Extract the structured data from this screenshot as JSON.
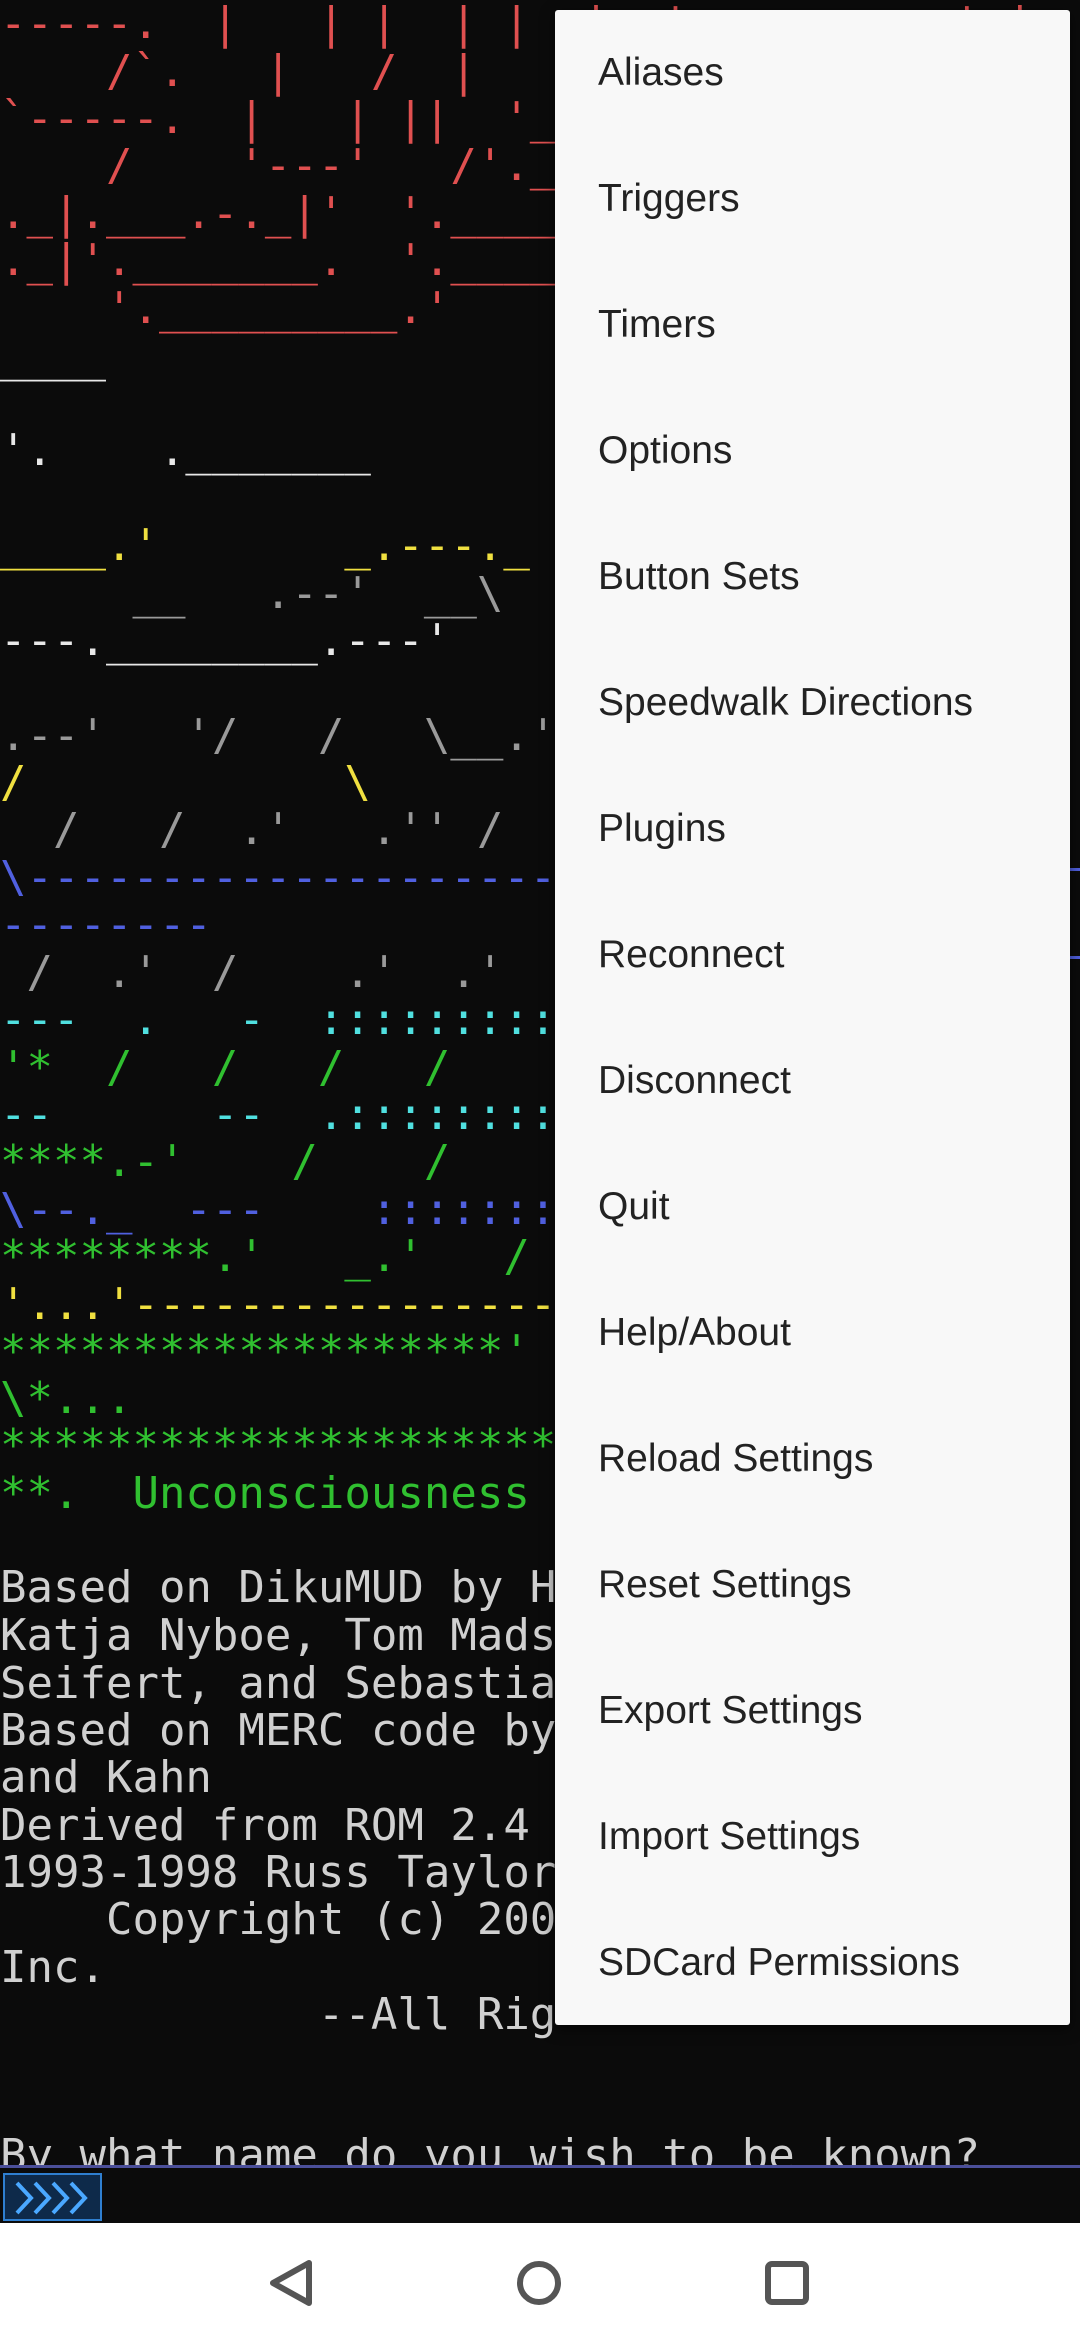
{
  "terminal": {
    "lines": [
      {
        "text": "-----.  |   | |  | |  |  '          ' |",
        "color": "#e05050"
      },
      {
        "text": "    /`.   |   /  |   '    `--._",
        "color": "#e05050"
      },
      {
        "text": "`-----.  |   | ||  '_____.-'",
        "color": "#e05050"
      },
      {
        "text": "    /    '---'   /'.____",
        "color": "#e05050"
      },
      {
        "text": "._|.___.-._|'  '.______.-'_|",
        "color": "#e05050"
      },
      {
        "text": "._|'._______.  '._______.'",
        "color": "#e05050"
      },
      {
        "text": "    '._________.'",
        "color": "#e05050"
      },
      {
        "text": "____",
        "color": "#e8e8e8"
      },
      {
        "text": "",
        "color": "#e8e8e8"
      },
      {
        "text": "'.    ._______",
        "color": "#e8e8e8"
      },
      {
        "text": "                         __",
        "color": "#9a9a9a"
      },
      {
        "text": "____.'       _.---._",
        "color": "#f0e040"
      },
      {
        "text": "     __   .--'  __\\       /",
        "color": "#9a9a9a"
      },
      {
        "text": "---.________.---'",
        "color": "#e8e8e8"
      },
      {
        "text": "",
        "color": "#e8e8e8"
      },
      {
        "text": ".--'   '/   /   \\__.'",
        "color": "#9a9a9a"
      },
      {
        "text": "/            \\",
        "color": "#f0e040"
      },
      {
        "text": "  /   /  .'   .'' /",
        "color": "#9a9a9a"
      },
      {
        "text": "\\-------------------------------------",
        "color": "#5060e0"
      },
      {
        "text": "--------",
        "color": "#5060e0"
      },
      {
        "text": " /  .'  /    .'  .'",
        "color": "#9a9a9a"
      },
      {
        "text": "---  .   -  :::::::::::::",
        "color": "#50e0e0"
      },
      {
        "text": "'*  /   /   /   /",
        "color": "#30c030"
      },
      {
        "text": "--      --  .:::::::::::",
        "color": "#50e0e0"
      },
      {
        "text": "****.-'    /    /",
        "color": "#30c030"
      },
      {
        "text": "\\--._  ---    :::::::::",
        "color": "#5060e0"
      },
      {
        "text": "********.'   _.'   /",
        "color": "#30c030"
      },
      {
        "text": "'...'-------------------",
        "color": "#f0e040"
      },
      {
        "text": "*******************'",
        "color": "#30c030"
      },
      {
        "text": "\\*...",
        "color": "#30c030"
      },
      {
        "text": "**********************",
        "color": "#30c030"
      },
      {
        "text": "**.  Unconsciousness",
        "color": "#30c030"
      },
      {
        "text": "",
        "color": "#d0d0d0"
      },
      {
        "text": "Based on DikuMUD by H",
        "color": "#d0d0d0"
      },
      {
        "text": "Katja Nyboe, Tom Mads",
        "color": "#d0d0d0"
      },
      {
        "text": "Seifert, and Sebastia",
        "color": "#d0d0d0"
      },
      {
        "text": "Based on MERC code by",
        "color": "#d0d0d0"
      },
      {
        "text": "and Kahn",
        "color": "#d0d0d0"
      },
      {
        "text": "Derived from ROM 2.4",
        "color": "#d0d0d0"
      },
      {
        "text": "1993-1998 Russ Taylor",
        "color": "#d0d0d0"
      },
      {
        "text": "    Copyright (c) 200",
        "color": "#d0d0d0"
      },
      {
        "text": "Inc.",
        "color": "#d0d0d0"
      },
      {
        "text": "            --All Rig",
        "color": "#d0d0d0"
      },
      {
        "text": "",
        "color": "#d0d0d0"
      },
      {
        "text": "",
        "color": "#d0d0d0"
      },
      {
        "text": "By what name do you wish to be known?",
        "color": "#d0d0d0"
      }
    ]
  },
  "input_bar": {
    "button_icon": "chevrons-right-icon",
    "accent": "#2f7fd0"
  },
  "menu": {
    "items": [
      "Aliases",
      "Triggers",
      "Timers",
      "Options",
      "Button Sets",
      "Speedwalk Directions",
      "Plugins",
      "Reconnect",
      "Disconnect",
      "Quit",
      "Help/About",
      "Reload Settings",
      "Reset Settings",
      "Export Settings",
      "Import Settings",
      "SDCard Permissions"
    ]
  },
  "navbar": {
    "back_icon": "back-triangle-icon",
    "home_icon": "home-circle-icon",
    "recents_icon": "recents-square-icon"
  }
}
